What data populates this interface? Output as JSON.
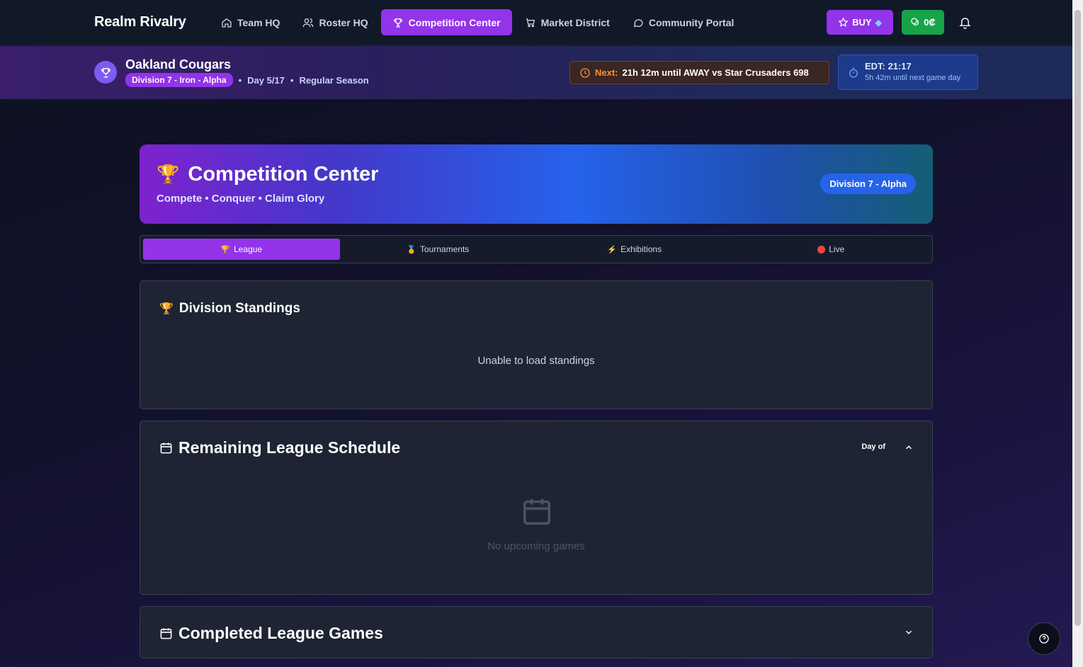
{
  "app": {
    "brand": "Realm Rivalry"
  },
  "nav": {
    "items": [
      {
        "label": "Team HQ",
        "icon": "home-icon"
      },
      {
        "label": "Roster HQ",
        "icon": "users-icon"
      },
      {
        "label": "Competition Center",
        "icon": "trophy-icon",
        "active": true
      },
      {
        "label": "Market District",
        "icon": "cart-icon"
      },
      {
        "label": "Community Portal",
        "icon": "chat-icon"
      }
    ],
    "buy_label": "BUY",
    "credits_label": "0₡"
  },
  "team": {
    "name": "Oakland Cougars",
    "division": "Division 7 - Iron - Alpha",
    "day": "Day 5/17",
    "season": "Regular Season",
    "next_label": "Next:",
    "next_text": "21h 12m until AWAY vs Star Crusaders 698",
    "edt_time": "EDT: 21:17",
    "edt_sub": "5h 42m until next game day"
  },
  "hero": {
    "title": "Competition Center",
    "subtitle": "Compete • Conquer • Claim Glory",
    "badge": "Division 7 - Alpha"
  },
  "tabs": [
    {
      "label": "League",
      "icon": "trophy-icon",
      "active": true
    },
    {
      "label": "Tournaments",
      "icon": "medal-icon"
    },
    {
      "label": "Exhibitions",
      "icon": "lightning-icon"
    },
    {
      "label": "Live",
      "icon": "live-dot-icon"
    }
  ],
  "standings": {
    "title": "Division Standings",
    "message": "Unable to load standings"
  },
  "schedule": {
    "title": "Remaining League Schedule",
    "day_of": "Day of",
    "message": "No upcoming games"
  },
  "completed": {
    "title": "Completed League Games"
  },
  "colors": {
    "accent": "#9333ea",
    "success": "#16a34a",
    "card": "#1e2433"
  }
}
